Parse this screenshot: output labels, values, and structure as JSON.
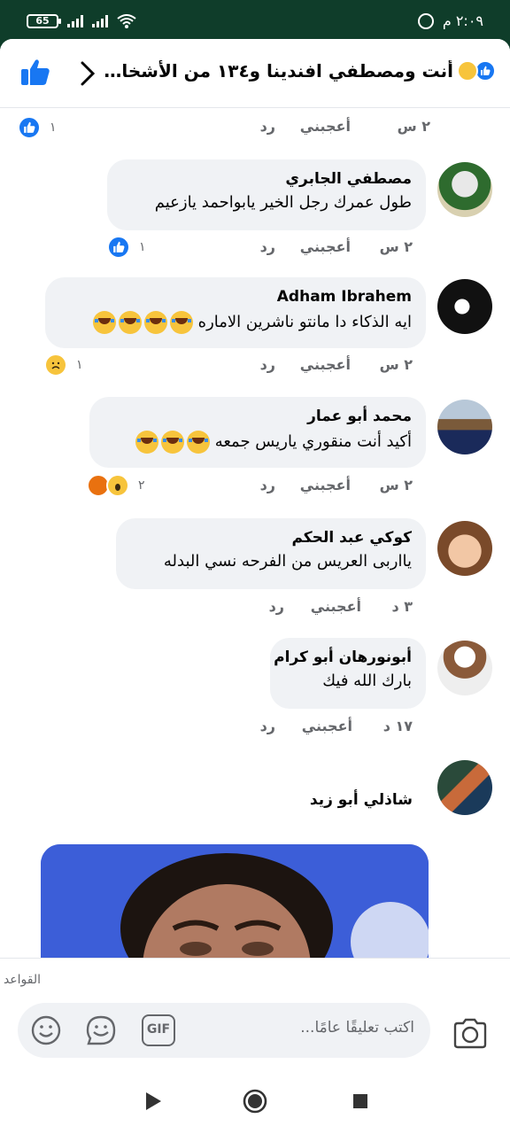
{
  "status_bar": {
    "time": "٢:٠٩ م",
    "battery": "65"
  },
  "header": {
    "title": "أنت ومصطفي افندينا و١٣٤ من الأشخاص ا..."
  },
  "comments": [
    {
      "meta": {
        "time": "٢ س",
        "like": "أعجبني",
        "reply": "رد"
      },
      "reactions": {
        "count": "١"
      }
    },
    {
      "name": "مصطفي الجابري",
      "text": "طول عمرك رجل الخير يابواحمد يازعيم",
      "meta": {
        "time": "٢ س",
        "like": "أعجبني",
        "reply": "رد"
      },
      "reactions": {
        "count": "١"
      }
    },
    {
      "name": "Adham Ibrahem",
      "text": "ايه الذكاء دا مانتو ناشرين الاماره",
      "meta": {
        "time": "٢ س",
        "like": "أعجبني",
        "reply": "رد"
      },
      "reactions": {
        "count": "١"
      }
    },
    {
      "name": "محمد أبو عمار",
      "text": "أكيد أنت منقوري ياريس جمعه",
      "meta": {
        "time": "٢ س",
        "like": "أعجبني",
        "reply": "رد"
      },
      "reactions": {
        "count": "٢"
      }
    },
    {
      "name": "كوكي عبد الحكم",
      "text": "يااربى العريس من الفرحه نسي البدله",
      "meta": {
        "time": "٣ د",
        "like": "أعجبني",
        "reply": "رد"
      }
    },
    {
      "name": "أبونورهان أبو كرام",
      "text": "بارك الله فيك",
      "meta": {
        "time": "١٧ د",
        "like": "أعجبني",
        "reply": "رد"
      }
    },
    {
      "name": "شاذلي أبو زيد"
    }
  ],
  "composer": {
    "rules": "القواعد",
    "placeholder": "اكتب تعليقًا عامًا...",
    "gif": "GIF"
  },
  "colors": {
    "facebook_blue": "#1877f2",
    "bubble": "#f0f2f5",
    "status_bar": "#0f3d2a"
  }
}
